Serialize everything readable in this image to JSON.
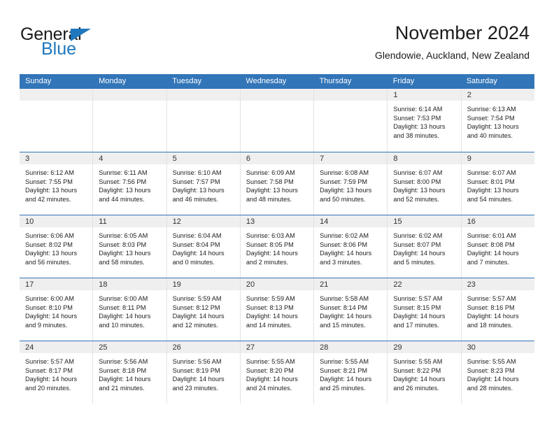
{
  "brand": {
    "name_top": "General",
    "name_bottom": "Blue",
    "triangle_icon": "blue-triangle-logo-mark"
  },
  "header": {
    "title": "November 2024",
    "subtitle": "Glendowie, Auckland, New Zealand"
  },
  "colors": {
    "header_blue": "#3275b8",
    "brand_blue": "#1f77bd",
    "day_band_gray": "#efefef",
    "text_dark": "#222222",
    "cell_divider": "#e3e3e3"
  },
  "weekdays": [
    "Sunday",
    "Monday",
    "Tuesday",
    "Wednesday",
    "Thursday",
    "Friday",
    "Saturday"
  ],
  "weeks": [
    [
      {
        "day": "",
        "empty": true,
        "sunrise": "",
        "sunset": "",
        "daylight_line1": "",
        "daylight_line2": ""
      },
      {
        "day": "",
        "empty": true,
        "sunrise": "",
        "sunset": "",
        "daylight_line1": "",
        "daylight_line2": ""
      },
      {
        "day": "",
        "empty": true,
        "sunrise": "",
        "sunset": "",
        "daylight_line1": "",
        "daylight_line2": ""
      },
      {
        "day": "",
        "empty": true,
        "sunrise": "",
        "sunset": "",
        "daylight_line1": "",
        "daylight_line2": ""
      },
      {
        "day": "",
        "empty": true,
        "sunrise": "",
        "sunset": "",
        "daylight_line1": "",
        "daylight_line2": ""
      },
      {
        "day": "1",
        "empty": false,
        "sunrise": "Sunrise: 6:14 AM",
        "sunset": "Sunset: 7:53 PM",
        "daylight_line1": "Daylight: 13 hours",
        "daylight_line2": "and 38 minutes."
      },
      {
        "day": "2",
        "empty": false,
        "sunrise": "Sunrise: 6:13 AM",
        "sunset": "Sunset: 7:54 PM",
        "daylight_line1": "Daylight: 13 hours",
        "daylight_line2": "and 40 minutes."
      }
    ],
    [
      {
        "day": "3",
        "empty": false,
        "sunrise": "Sunrise: 6:12 AM",
        "sunset": "Sunset: 7:55 PM",
        "daylight_line1": "Daylight: 13 hours",
        "daylight_line2": "and 42 minutes."
      },
      {
        "day": "4",
        "empty": false,
        "sunrise": "Sunrise: 6:11 AM",
        "sunset": "Sunset: 7:56 PM",
        "daylight_line1": "Daylight: 13 hours",
        "daylight_line2": "and 44 minutes."
      },
      {
        "day": "5",
        "empty": false,
        "sunrise": "Sunrise: 6:10 AM",
        "sunset": "Sunset: 7:57 PM",
        "daylight_line1": "Daylight: 13 hours",
        "daylight_line2": "and 46 minutes."
      },
      {
        "day": "6",
        "empty": false,
        "sunrise": "Sunrise: 6:09 AM",
        "sunset": "Sunset: 7:58 PM",
        "daylight_line1": "Daylight: 13 hours",
        "daylight_line2": "and 48 minutes."
      },
      {
        "day": "7",
        "empty": false,
        "sunrise": "Sunrise: 6:08 AM",
        "sunset": "Sunset: 7:59 PM",
        "daylight_line1": "Daylight: 13 hours",
        "daylight_line2": "and 50 minutes."
      },
      {
        "day": "8",
        "empty": false,
        "sunrise": "Sunrise: 6:07 AM",
        "sunset": "Sunset: 8:00 PM",
        "daylight_line1": "Daylight: 13 hours",
        "daylight_line2": "and 52 minutes."
      },
      {
        "day": "9",
        "empty": false,
        "sunrise": "Sunrise: 6:07 AM",
        "sunset": "Sunset: 8:01 PM",
        "daylight_line1": "Daylight: 13 hours",
        "daylight_line2": "and 54 minutes."
      }
    ],
    [
      {
        "day": "10",
        "empty": false,
        "sunrise": "Sunrise: 6:06 AM",
        "sunset": "Sunset: 8:02 PM",
        "daylight_line1": "Daylight: 13 hours",
        "daylight_line2": "and 56 minutes."
      },
      {
        "day": "11",
        "empty": false,
        "sunrise": "Sunrise: 6:05 AM",
        "sunset": "Sunset: 8:03 PM",
        "daylight_line1": "Daylight: 13 hours",
        "daylight_line2": "and 58 minutes."
      },
      {
        "day": "12",
        "empty": false,
        "sunrise": "Sunrise: 6:04 AM",
        "sunset": "Sunset: 8:04 PM",
        "daylight_line1": "Daylight: 14 hours",
        "daylight_line2": "and 0 minutes."
      },
      {
        "day": "13",
        "empty": false,
        "sunrise": "Sunrise: 6:03 AM",
        "sunset": "Sunset: 8:05 PM",
        "daylight_line1": "Daylight: 14 hours",
        "daylight_line2": "and 2 minutes."
      },
      {
        "day": "14",
        "empty": false,
        "sunrise": "Sunrise: 6:02 AM",
        "sunset": "Sunset: 8:06 PM",
        "daylight_line1": "Daylight: 14 hours",
        "daylight_line2": "and 3 minutes."
      },
      {
        "day": "15",
        "empty": false,
        "sunrise": "Sunrise: 6:02 AM",
        "sunset": "Sunset: 8:07 PM",
        "daylight_line1": "Daylight: 14 hours",
        "daylight_line2": "and 5 minutes."
      },
      {
        "day": "16",
        "empty": false,
        "sunrise": "Sunrise: 6:01 AM",
        "sunset": "Sunset: 8:08 PM",
        "daylight_line1": "Daylight: 14 hours",
        "daylight_line2": "and 7 minutes."
      }
    ],
    [
      {
        "day": "17",
        "empty": false,
        "sunrise": "Sunrise: 6:00 AM",
        "sunset": "Sunset: 8:10 PM",
        "daylight_line1": "Daylight: 14 hours",
        "daylight_line2": "and 9 minutes."
      },
      {
        "day": "18",
        "empty": false,
        "sunrise": "Sunrise: 6:00 AM",
        "sunset": "Sunset: 8:11 PM",
        "daylight_line1": "Daylight: 14 hours",
        "daylight_line2": "and 10 minutes."
      },
      {
        "day": "19",
        "empty": false,
        "sunrise": "Sunrise: 5:59 AM",
        "sunset": "Sunset: 8:12 PM",
        "daylight_line1": "Daylight: 14 hours",
        "daylight_line2": "and 12 minutes."
      },
      {
        "day": "20",
        "empty": false,
        "sunrise": "Sunrise: 5:59 AM",
        "sunset": "Sunset: 8:13 PM",
        "daylight_line1": "Daylight: 14 hours",
        "daylight_line2": "and 14 minutes."
      },
      {
        "day": "21",
        "empty": false,
        "sunrise": "Sunrise: 5:58 AM",
        "sunset": "Sunset: 8:14 PM",
        "daylight_line1": "Daylight: 14 hours",
        "daylight_line2": "and 15 minutes."
      },
      {
        "day": "22",
        "empty": false,
        "sunrise": "Sunrise: 5:57 AM",
        "sunset": "Sunset: 8:15 PM",
        "daylight_line1": "Daylight: 14 hours",
        "daylight_line2": "and 17 minutes."
      },
      {
        "day": "23",
        "empty": false,
        "sunrise": "Sunrise: 5:57 AM",
        "sunset": "Sunset: 8:16 PM",
        "daylight_line1": "Daylight: 14 hours",
        "daylight_line2": "and 18 minutes."
      }
    ],
    [
      {
        "day": "24",
        "empty": false,
        "sunrise": "Sunrise: 5:57 AM",
        "sunset": "Sunset: 8:17 PM",
        "daylight_line1": "Daylight: 14 hours",
        "daylight_line2": "and 20 minutes."
      },
      {
        "day": "25",
        "empty": false,
        "sunrise": "Sunrise: 5:56 AM",
        "sunset": "Sunset: 8:18 PM",
        "daylight_line1": "Daylight: 14 hours",
        "daylight_line2": "and 21 minutes."
      },
      {
        "day": "26",
        "empty": false,
        "sunrise": "Sunrise: 5:56 AM",
        "sunset": "Sunset: 8:19 PM",
        "daylight_line1": "Daylight: 14 hours",
        "daylight_line2": "and 23 minutes."
      },
      {
        "day": "27",
        "empty": false,
        "sunrise": "Sunrise: 5:55 AM",
        "sunset": "Sunset: 8:20 PM",
        "daylight_line1": "Daylight: 14 hours",
        "daylight_line2": "and 24 minutes."
      },
      {
        "day": "28",
        "empty": false,
        "sunrise": "Sunrise: 5:55 AM",
        "sunset": "Sunset: 8:21 PM",
        "daylight_line1": "Daylight: 14 hours",
        "daylight_line2": "and 25 minutes."
      },
      {
        "day": "29",
        "empty": false,
        "sunrise": "Sunrise: 5:55 AM",
        "sunset": "Sunset: 8:22 PM",
        "daylight_line1": "Daylight: 14 hours",
        "daylight_line2": "and 26 minutes."
      },
      {
        "day": "30",
        "empty": false,
        "sunrise": "Sunrise: 5:55 AM",
        "sunset": "Sunset: 8:23 PM",
        "daylight_line1": "Daylight: 14 hours",
        "daylight_line2": "and 28 minutes."
      }
    ]
  ]
}
